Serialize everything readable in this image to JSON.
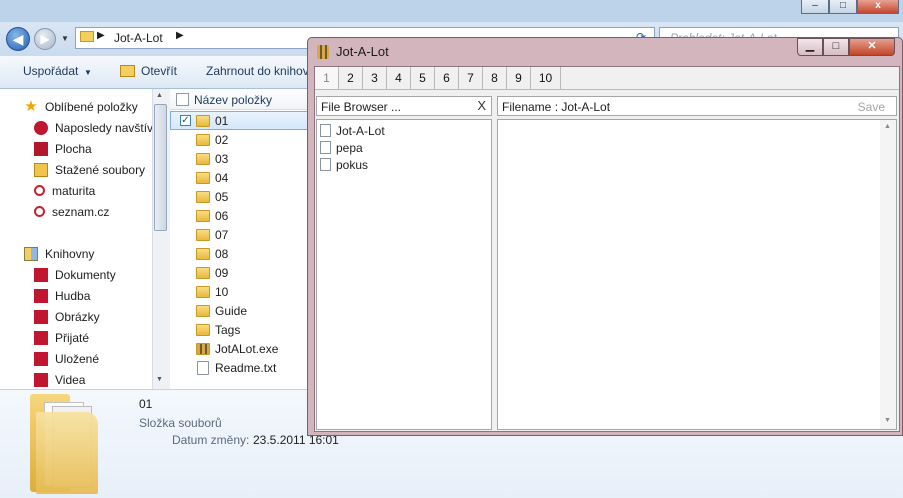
{
  "explorer": {
    "address": {
      "path": "Jot-A-Lot"
    },
    "search": {
      "placeholder": "Prohledat: Jot-A-Lot"
    },
    "toolbar": {
      "organize": "Uspořádat",
      "open": "Otevřít",
      "include": "Zahrnout do knihov"
    },
    "favorites": {
      "header": "Oblíbené položky",
      "items": [
        "Naposledy navštív",
        "Plocha",
        "Stažené soubory",
        "maturita",
        "seznam.cz"
      ]
    },
    "libraries": {
      "header": "Knihovny",
      "items": [
        "Dokumenty",
        "Hudba",
        "Obrázky",
        "Přijaté",
        "Uložené",
        "Videa"
      ]
    },
    "files": {
      "column_header": "Název položky",
      "items": [
        "01",
        "02",
        "03",
        "04",
        "05",
        "06",
        "07",
        "08",
        "09",
        "10",
        "Guide",
        "Tags",
        "JotALot.exe",
        "Readme.txt"
      ],
      "selected": "01"
    },
    "details": {
      "name": "01",
      "type": "Složka souborů",
      "date_label": "Datum změny:",
      "date_value": "23.5.2011 16:01"
    }
  },
  "jot": {
    "title": "Jot-A-Lot",
    "tabs": [
      "1",
      "2",
      "3",
      "4",
      "5",
      "6",
      "7",
      "8",
      "9",
      "10"
    ],
    "active_tab": "1",
    "file_browser": {
      "header": "File Browser ...",
      "close": "X",
      "items": [
        "Jot-A-Lot",
        "pepa",
        "pokus"
      ]
    },
    "editor": {
      "filename_label": "Filename : Jot-A-Lot",
      "save": "Save"
    }
  }
}
